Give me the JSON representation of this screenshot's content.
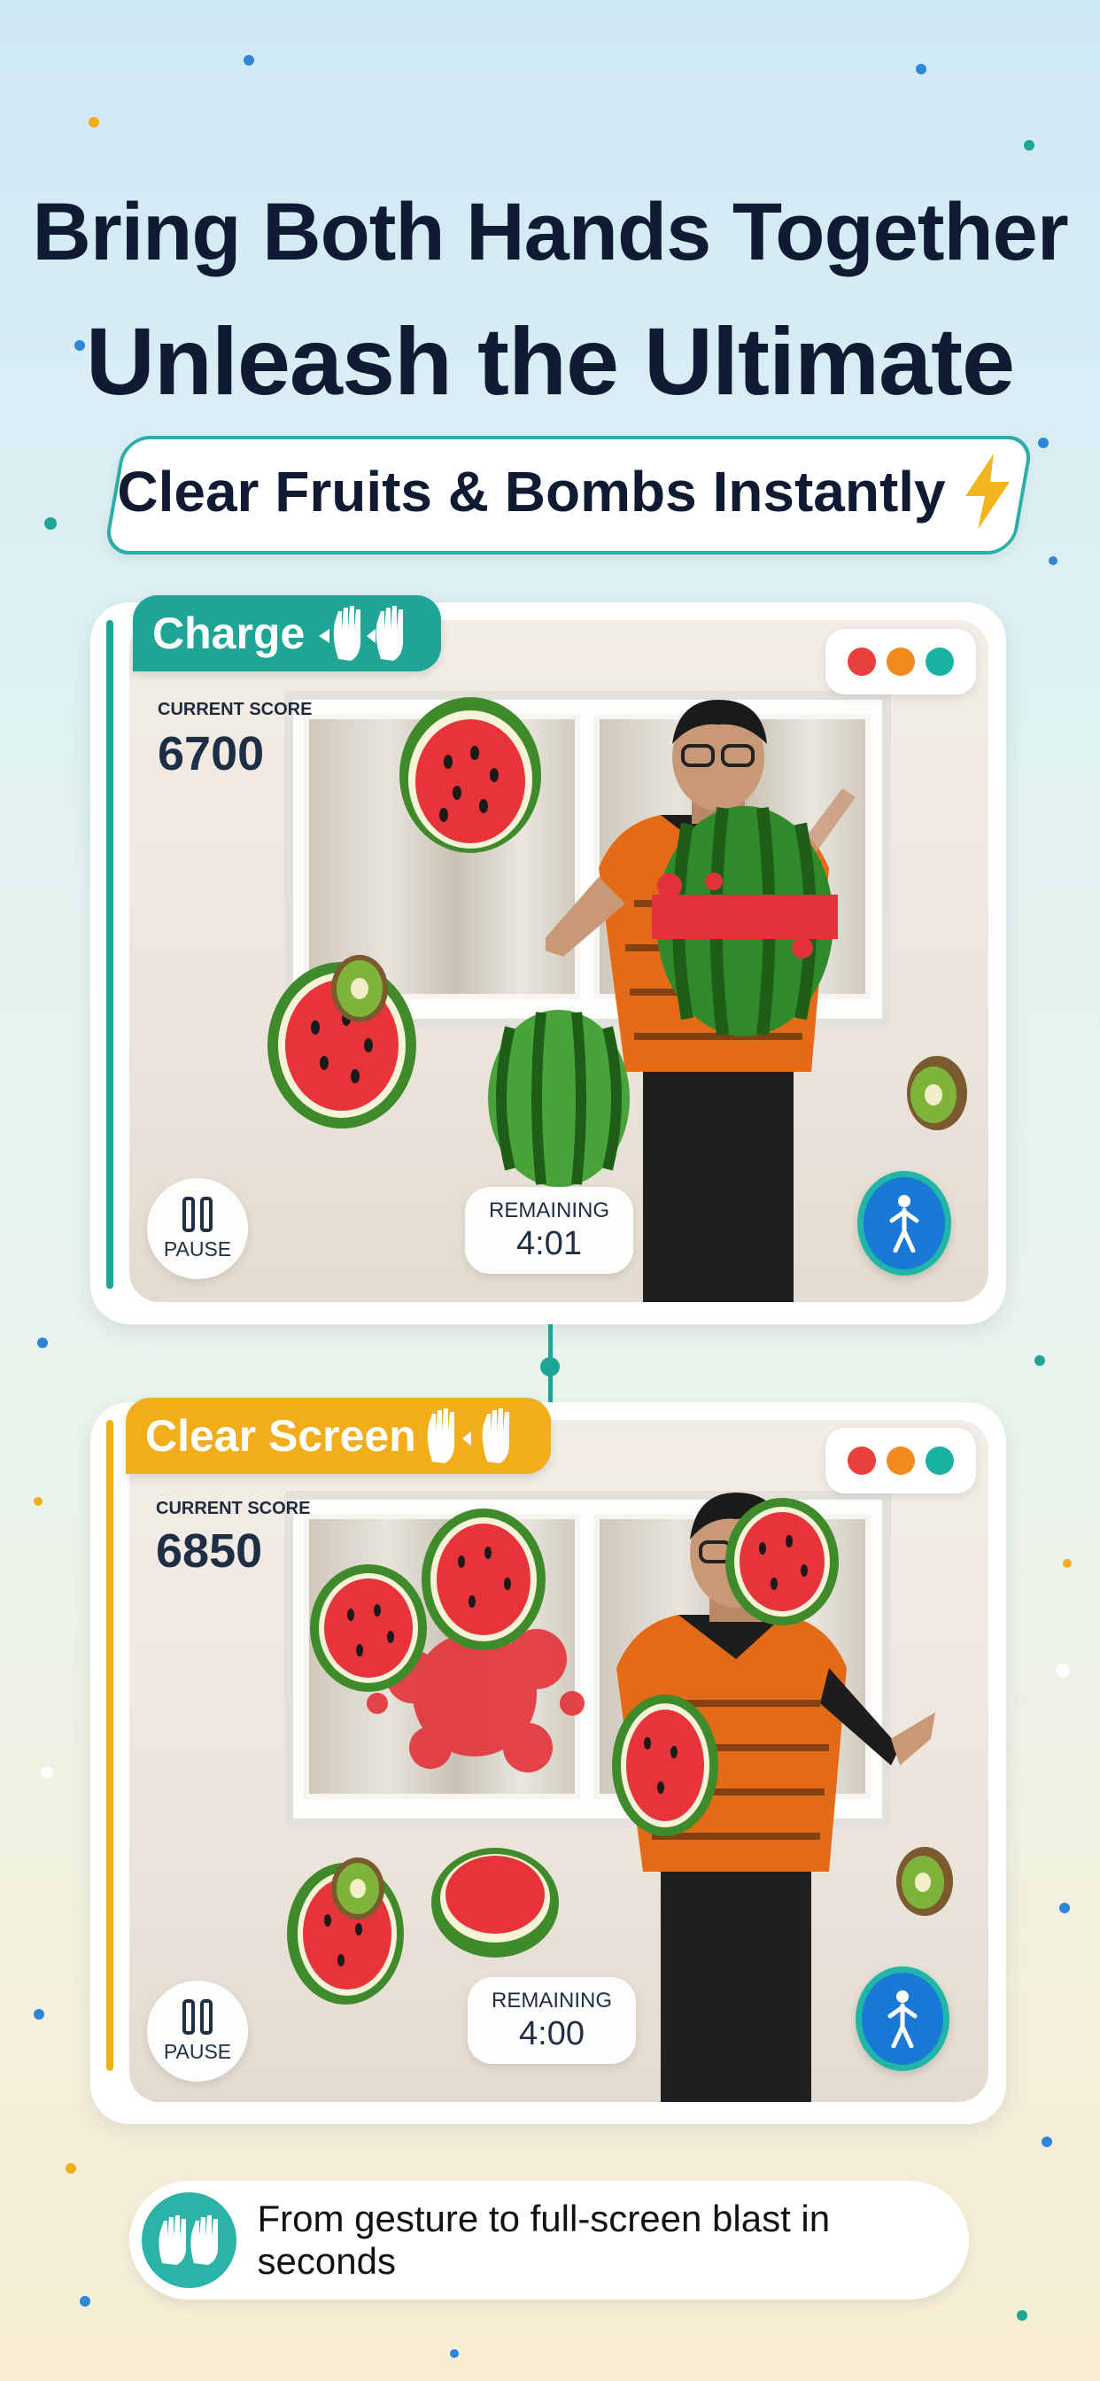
{
  "headline": {
    "line1": "Bring Both Hands Together",
    "line2": "Unleash the Ultimate",
    "subtitle": "Clear Fruits & Bombs Instantly"
  },
  "colors": {
    "teal": "#1fa596",
    "yellow": "#f2ae1a",
    "navy": "#0f1b33",
    "light_red": "#e8403a",
    "light_orange": "#f28a1e",
    "light_teal": "#19b3a3"
  },
  "panels": [
    {
      "mode_label": "Charge",
      "mode_icon": "hands-apart-icon",
      "score_label": "CURRENT SCORE",
      "score_value": "6700",
      "pause_label": "PAUSE",
      "remaining_label": "REMAINING",
      "remaining_value": "4:01",
      "person_icon": "person-standing-icon"
    },
    {
      "mode_label": "Clear Screen",
      "mode_icon": "hands-together-icon",
      "score_label": "CURRENT SCORE",
      "score_value": "6850",
      "pause_label": "PAUSE",
      "remaining_label": "REMAINING",
      "remaining_value": "4:00",
      "person_icon": "person-standing-icon"
    }
  ],
  "footer": {
    "text": "From gesture to full-screen blast in seconds",
    "icon": "clapping-hands-icon"
  }
}
